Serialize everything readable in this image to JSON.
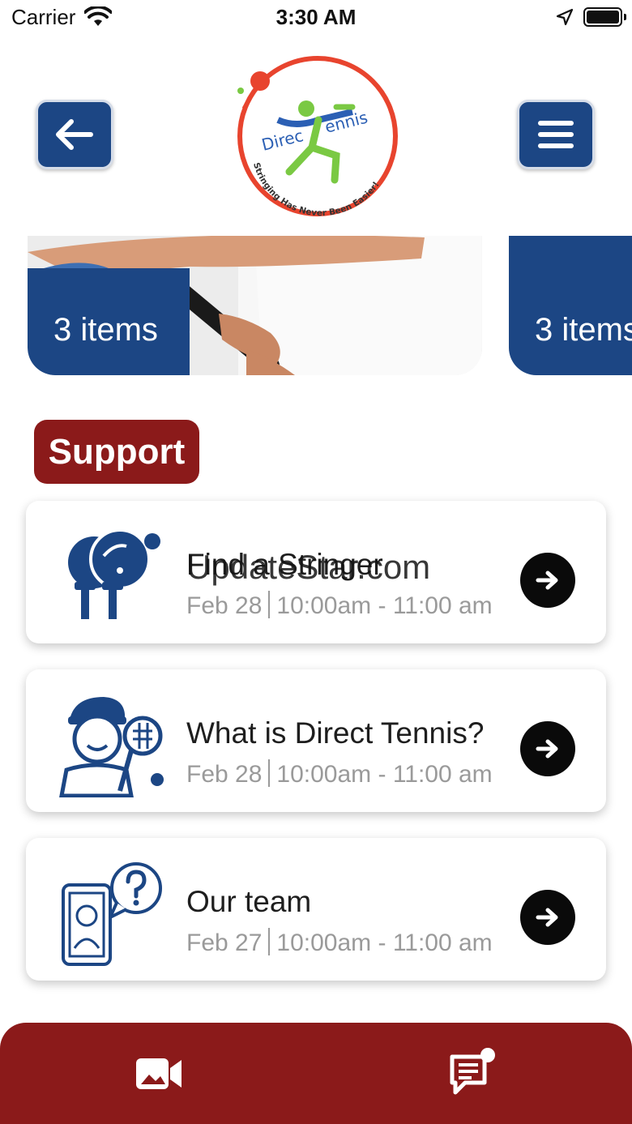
{
  "status_bar": {
    "carrier": "Carrier",
    "time": "3:30 AM"
  },
  "header": {
    "back_icon": "arrow-left-icon",
    "menu_icon": "hamburger-menu-icon",
    "logo_text_line1": "Direc",
    "logo_text_line2": "ennis",
    "logo_tagline": "Stringing Has Never Been Easier!"
  },
  "carousel": {
    "cards": [
      {
        "label": "3 items"
      },
      {
        "label": "3 items"
      }
    ]
  },
  "support": {
    "title": "Support",
    "items": [
      {
        "title": "Find a Stringer",
        "date": "Feb 28",
        "time": "10:00am - 11:00 am",
        "icon": "ping-pong-paddles-icon"
      },
      {
        "title": "What is Direct Tennis?",
        "date": "Feb 28",
        "time": "10:00am - 11:00 am",
        "icon": "tennis-player-icon"
      },
      {
        "title": "Our team",
        "date": "Feb 27",
        "time": "10:00am - 11:00 am",
        "icon": "phone-question-icon"
      }
    ],
    "watermark": "UpdateStar.com"
  },
  "bottom_nav": {
    "left_icon": "video-camera-icon",
    "right_icon": "chat-notification-icon"
  },
  "colors": {
    "brand_blue": "#1c4684",
    "brand_red": "#8b1a1a",
    "arrow_bg": "#0a0a0a"
  }
}
